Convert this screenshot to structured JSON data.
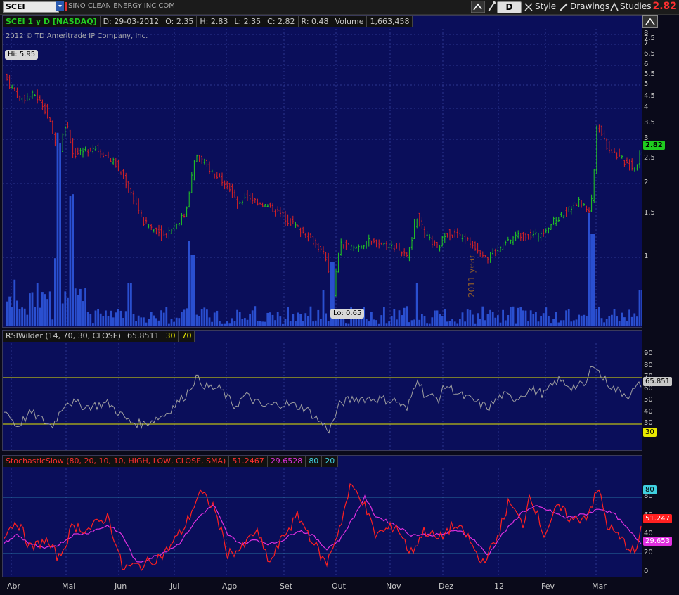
{
  "toolbar": {
    "symbol": "SCEI",
    "company": "SINO CLEAN ENERGY INC COM",
    "aggregation": "D",
    "style_label": "Style",
    "drawings_label": "Drawings",
    "studies_label": "Studies",
    "last_price": "2.82"
  },
  "price_panel": {
    "header": {
      "title": "SCEI 1 y D [NASDAQ]",
      "date": "D: 29-03-2012",
      "open": "O: 2.35",
      "high": "H: 2.83",
      "low": "L: 2.35",
      "close": "C: 2.82",
      "range": "R: 0.48",
      "volume_label": "Volume",
      "volume_value": "1,663,458"
    },
    "copyright": "2012 © TD Ameritrade IP Company, Inc.",
    "hi_label": "Hi: 5.95",
    "lo_label": "Lo: 0.65",
    "year_marker": "2011 year",
    "price_tag": "2.82",
    "y_ticks": [
      "8",
      "7.5",
      "7",
      "6.5",
      "6",
      "5.5",
      "5",
      "4.5",
      "4",
      "3.5",
      "3",
      "2.5",
      "2",
      "1.5",
      "1"
    ]
  },
  "rsi_panel": {
    "label": "RSIWilder (14, 70, 30, CLOSE)",
    "value": "65.8511",
    "lower": "30",
    "upper": "70",
    "tag": "65.851",
    "lower_tag": "30",
    "y_ticks": [
      "90",
      "80",
      "70",
      "60",
      "50",
      "40",
      "30",
      "20"
    ]
  },
  "stoch_panel": {
    "label": "StochasticSlow (80, 20, 10, 10, HIGH, LOW, CLOSE, SMA)",
    "k_value": "51.2467",
    "d_value": "29.6528",
    "upper": "80",
    "lower": "20",
    "k_tag": "51.247",
    "d_tag": "29.653",
    "upper_tag": "80",
    "y_ticks": [
      "80",
      "60",
      "40",
      "20",
      "0"
    ]
  },
  "x_axis": {
    "labels": [
      "Abr",
      "Mai",
      "Jun",
      "Jul",
      "Ago",
      "Set",
      "Out",
      "Nov",
      "Dez",
      "12",
      "Fev",
      "Mar"
    ]
  },
  "colors": {
    "up": "#22cc22",
    "down": "#dd2222",
    "volume": "#2a4fd0",
    "rsi_line": "#a0a0a0",
    "stoch_k": "#ff2020",
    "stoch_d": "#e030e0",
    "rsi_bands": "#e8e800",
    "stoch_bands": "#40d0e0"
  }
}
